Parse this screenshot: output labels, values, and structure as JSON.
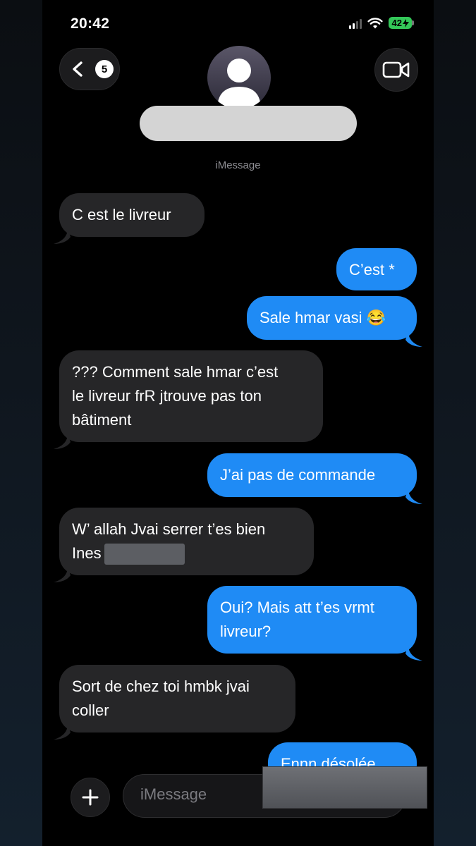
{
  "status_bar": {
    "time": "20:42",
    "battery": "42"
  },
  "nav": {
    "back_badge": "5"
  },
  "contact": {
    "service": "iMessage"
  },
  "messages": [
    {
      "dir": "in",
      "text": "C est le livreur"
    },
    {
      "dir": "out",
      "text": "C’est *"
    },
    {
      "dir": "out",
      "text": "Sale hmar vasi 😂"
    },
    {
      "dir": "in",
      "text": "??? Comment sale hmar c’est\nle livreur frR jtrouve pas ton\nbâtiment"
    },
    {
      "dir": "out",
      "text": "J’ai pas de commande"
    },
    {
      "dir": "in",
      "line1": "W’ allah Jvai serrer t’es bien",
      "line2": "Ines"
    },
    {
      "dir": "out",
      "text": "Oui? Mais att t’es vrmt\nlivreur?"
    },
    {
      "dir": "in",
      "text": "Sort de chez toi hmbk jvai\ncoller"
    },
    {
      "dir": "out",
      "text": "Ennn désolée"
    }
  ],
  "composer": {
    "placeholder": "iMessage"
  },
  "colors": {
    "incoming": "#262628",
    "outgoing": "#1f8bf5",
    "background": "#000000"
  },
  "icons": [
    "chevron-left-icon",
    "video-camera-icon",
    "person-icon",
    "plus-icon",
    "wifi-icon",
    "signal-icon",
    "battery-icon"
  ]
}
